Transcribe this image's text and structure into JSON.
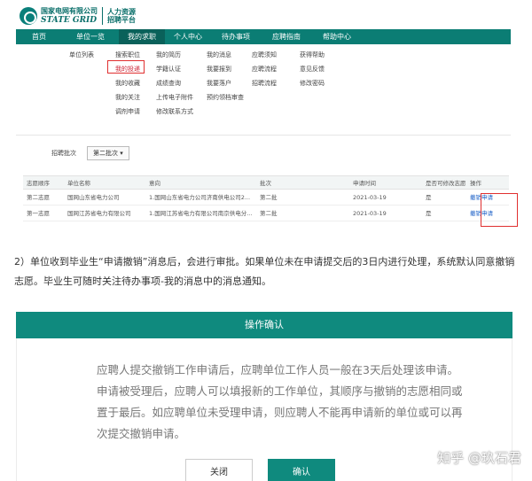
{
  "brand": {
    "company_cn": "国家电网有限公司",
    "company_en": "STATE GRID",
    "platform_line1": "人力资源",
    "platform_line2": "招聘平台"
  },
  "nav": [
    "首页",
    "单位一览",
    "我的求职",
    "个人中心",
    "待办事项",
    "应聘指南",
    "帮助中心"
  ],
  "nav_active_index": 2,
  "mega_menu": {
    "col1": [
      "单位列表"
    ],
    "col2": [
      "搜索职位",
      "我的投递",
      "我的收藏",
      "我的关注",
      "调剂申请"
    ],
    "col3": [
      "我的简历",
      "学籍认证",
      "成绩查询",
      "上传电子附件",
      "修改联系方式"
    ],
    "col4": [
      "我的消息",
      "我要报到",
      "我要落户",
      "预约领档审查"
    ],
    "col5": [
      "应聘须知",
      "应聘流程",
      "招聘流程"
    ],
    "col6": [
      "获得帮助",
      "意见反馈",
      "修改密码"
    ]
  },
  "batch": {
    "label": "招聘批次",
    "selected": "第二批次"
  },
  "table": {
    "headers": [
      "志愿顺序",
      "单位名称",
      "意向",
      "批次",
      "申请时间",
      "是否可修改志愿",
      "操作"
    ],
    "rows": [
      [
        "第二志愿",
        "国网山东省电力公司",
        "1.国网山东省电力公司济南供电公司2...",
        "第二批",
        "2021-03-19",
        "是",
        "撤销申请"
      ],
      [
        "第一志愿",
        "国网江苏省电力有限公司",
        "1.国网江苏省电力有限公司南京供电分...",
        "第二批",
        "2021-03-19",
        "是",
        "撤销申请"
      ]
    ]
  },
  "paragraph": "2）单位收到毕业生“申请撤销”消息后，会进行审批。如果单位未在申请提交后的3日内进行处理，系统默认同意撤销志愿。毕业生可随时关注待办事项-我的消息中的消息通知。",
  "dialog": {
    "title": "操作确认",
    "message": "应聘人提交撤销工作申请后，应聘单位工作人员一般在3天后处理该申请。申请被受理后，应聘人可以填报新的工作单位，其顺序与撤销的志愿相同或置于最后。如应聘单位未受理申请，则应聘人不能再申请新的单位或可以再次提交撤销申请。",
    "close_label": "关闭",
    "confirm_label": "确认"
  },
  "watermark": "知乎 @玖石君",
  "colors": {
    "primary": "#0b7d74",
    "highlight": "#e03030",
    "link": "#1a5fc7"
  }
}
